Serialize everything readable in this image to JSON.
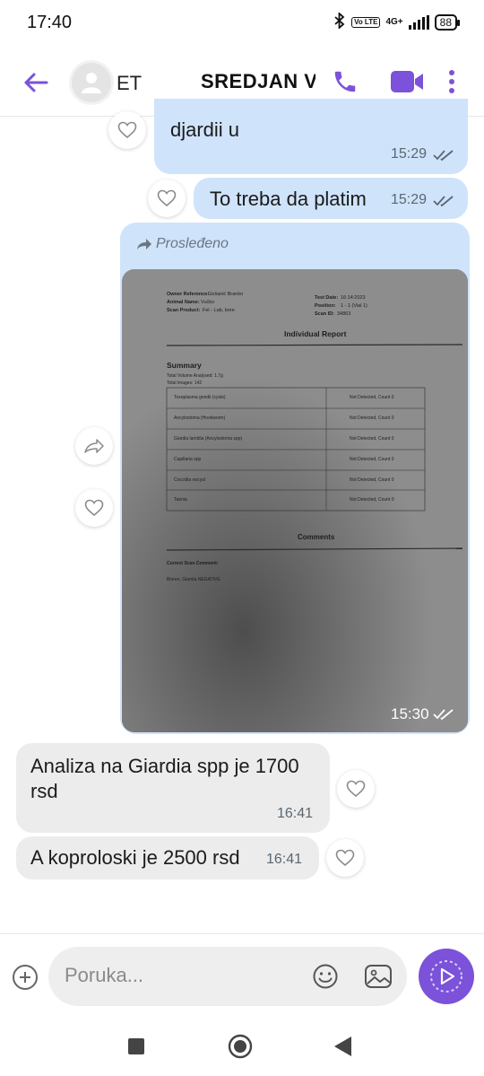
{
  "status_bar": {
    "time": "17:40",
    "volte": "Vo LTE",
    "network": "4G+",
    "battery": "88"
  },
  "header": {
    "avatar_name": "ET",
    "contact_name": "SREDJAN VE"
  },
  "messages": [
    {
      "direction": "outgoing",
      "text": "djardii u",
      "time": "15:29"
    },
    {
      "direction": "outgoing",
      "text": "To treba da platim",
      "time": "15:29"
    },
    {
      "direction": "outgoing",
      "forwarded_label": "Prosleđeno",
      "time": "15:30",
      "photo": {
        "owner_reference_label": "Owner Reference:",
        "owner_reference_value": "Gošanić Branko",
        "animal_name_label": "Animal Name:",
        "animal_name_value": "Vučko",
        "scan_product_label": "Scan Product:",
        "scan_product_value": "Fel - Lab, bore",
        "test_date_label": "Test Date:",
        "test_date_value": "16:14:2023",
        "position_label": "Position:",
        "position_value": "1 - 1 (Vial 1)",
        "scan_id_label": "Scan ID:",
        "scan_id_value": "34863",
        "report_title": "Individual Report",
        "summary_heading": "Summary",
        "summary_line_1": "Total Volume Analysed: 1.7g",
        "summary_line_2": "Total images: 142",
        "rows": [
          {
            "name": "Toxoplasma gondii (cysts)",
            "result": "Not Detected, Count 0"
          },
          {
            "name": "Ancylostoma (Hookworm)",
            "result": "Not Detected, Count 0"
          },
          {
            "name": "Giardia lamblia (Ancylostoma spp)",
            "result": "Not Detected, Count 0"
          },
          {
            "name": "Capillaria spp",
            "result": "Not Detected, Count 0"
          },
          {
            "name": "Coccidia oocyst",
            "result": "Not Detected, Count 0"
          },
          {
            "name": "Taenia",
            "result": "Not Detected, Count 0"
          }
        ],
        "comments_heading": "Comments",
        "current_comment_label": "Current Scan Comment:",
        "comment_text": "Bioreo, Giardia NEGATIVE"
      }
    },
    {
      "direction": "incoming",
      "text_line_1": "Analiza na Giardia spp je 1700",
      "text_line_2": "rsd",
      "time": "16:41"
    },
    {
      "direction": "incoming",
      "text": "A koproloski je 2500 rsd",
      "time": "16:41"
    }
  ],
  "composer": {
    "placeholder": "Poruka..."
  },
  "icons": {
    "back": "arrow-left-icon",
    "call": "phone-icon",
    "video": "video-camera-icon",
    "more": "more-vertical-icon",
    "forward": "forward-icon",
    "like": "heart-icon",
    "add": "plus-circle-icon",
    "emoji": "emoji-icon",
    "gallery": "gallery-icon",
    "send": "send-icon",
    "nav_recents": "square-icon",
    "nav_home": "home-circle-icon",
    "nav_back": "triangle-back-icon"
  },
  "colors": {
    "accent": "#7b52d9",
    "outgoing_bubble": "#cfe3fb",
    "incoming_bubble": "#ececec"
  }
}
